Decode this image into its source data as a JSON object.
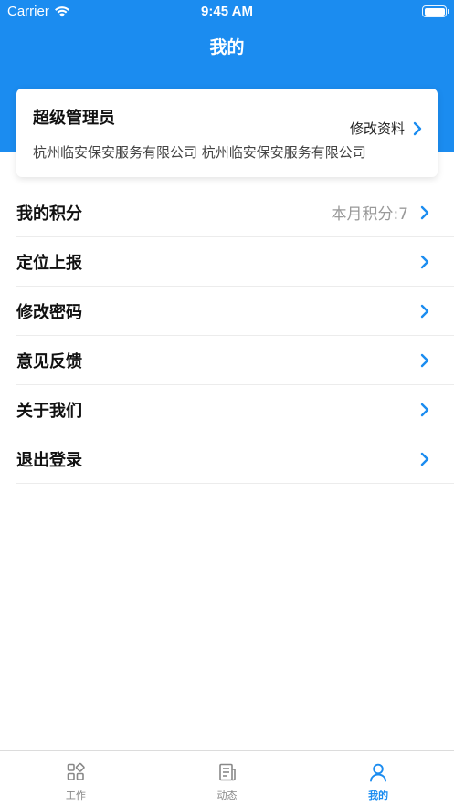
{
  "status_bar": {
    "carrier": "Carrier",
    "time": "9:45 AM"
  },
  "header": {
    "title": "我的"
  },
  "profile": {
    "name": "超级管理员",
    "edit_label": "修改资料",
    "company": "杭州临安保安服务有限公司 杭州临安保安服务有限公司"
  },
  "menu": {
    "items": [
      {
        "label": "我的积分",
        "value": "本月积分:7"
      },
      {
        "label": "定位上报",
        "value": ""
      },
      {
        "label": "修改密码",
        "value": ""
      },
      {
        "label": "意见反馈",
        "value": ""
      },
      {
        "label": "关于我们",
        "value": ""
      },
      {
        "label": "退出登录",
        "value": ""
      }
    ]
  },
  "tabbar": {
    "tabs": [
      {
        "label": "工作",
        "icon": "grid-icon",
        "active": false
      },
      {
        "label": "动态",
        "icon": "news-icon",
        "active": false
      },
      {
        "label": "我的",
        "icon": "person-icon",
        "active": true
      }
    ]
  },
  "colors": {
    "accent": "#1b8cf0",
    "chevron": "#1b8cf0",
    "muted_text": "#9a9a9a",
    "inactive_tab": "#888888"
  }
}
